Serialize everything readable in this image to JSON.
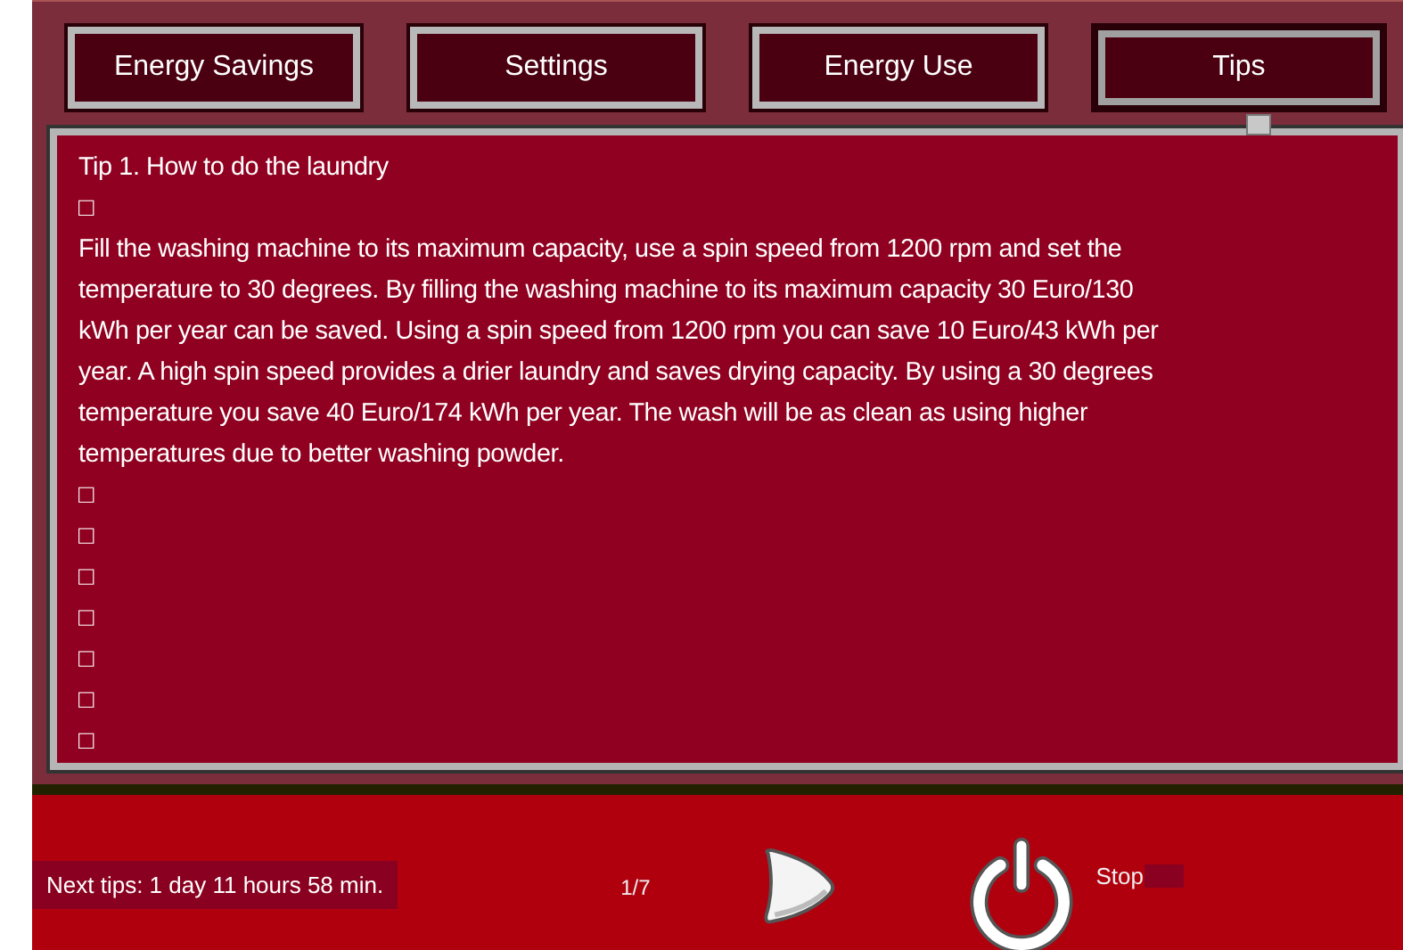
{
  "tabs": [
    {
      "label": "Energy Savings",
      "selected": false
    },
    {
      "label": "Settings",
      "selected": false
    },
    {
      "label": "Energy Use",
      "selected": false
    },
    {
      "label": "Tips",
      "selected": true
    }
  ],
  "tip": {
    "title": "Tip 1. How to do the laundry",
    "lines": [
      "□",
      "Fill the washing machine to its maximum capacity, use a spin speed from 1200 rpm and set the",
      "temperature to 30 degrees. By filling the washing machine to its maximum capacity 30 Euro/130",
      "kWh per year can be saved. Using a spin speed from 1200 rpm you can save 10 Euro/43 kWh per",
      "year. A high spin speed provides a drier laundry and saves drying capacity. By using a 30 degrees",
      "temperature you save 40 Euro/174 kWh per year. The wash will be as clean as using higher",
      "temperatures due to better washing powder.",
      "□",
      "□",
      "□",
      "□",
      "□",
      "□",
      "□"
    ]
  },
  "footer": {
    "next_tips": "Next tips: 1 day 11 hours 58 min.",
    "page": "1/7",
    "stop_label": "Stop"
  }
}
